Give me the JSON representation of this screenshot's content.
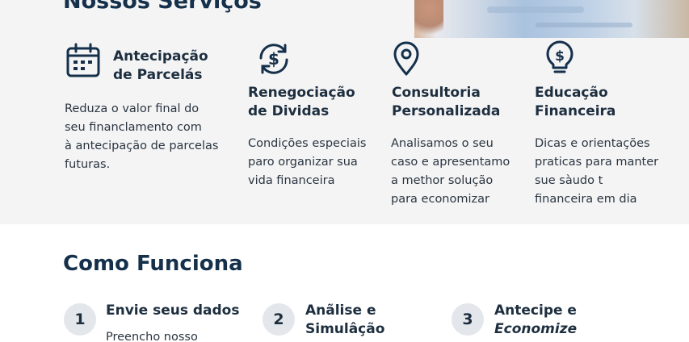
{
  "services": {
    "title": "Nossos Serviços",
    "items": [
      {
        "icon": "calendar-icon",
        "title_lines": [
          "Antecipação",
          "de Parcelás"
        ],
        "desc_lines": [
          "Reduza o valor final do",
          "seu financlamento com",
          "à antecipação de parcelas",
          "futuras."
        ]
      },
      {
        "icon": "refresh-dollar-icon",
        "title_lines": [
          "Renegociação",
          "de Dividas"
        ],
        "desc_lines": [
          "Condições especiais",
          "paro organizar sua",
          "vida financeira"
        ]
      },
      {
        "icon": "location-pin-icon",
        "title_lines": [
          "Consultoria",
          "Personalizada"
        ],
        "desc_lines": [
          "Analisamos o seu",
          "caso e apresentamo",
          "a methor solução",
          "para economizar"
        ]
      },
      {
        "icon": "lightbulb-dollar-icon",
        "title_lines": [
          "Educação",
          "Financeira"
        ],
        "desc_lines": [
          "Dicas e orientações",
          "praticas para manter",
          "sue sàudo t",
          "financeira  em dia"
        ]
      }
    ]
  },
  "how": {
    "title": "Como Funciona",
    "steps": [
      {
        "number": "1",
        "title_lines": [
          "Envie seus dados"
        ],
        "desc": "Preencho nosso"
      },
      {
        "number": "2",
        "title_lines": [
          "Anãlise e",
          "Simulâção"
        ]
      },
      {
        "number": "3",
        "title_lines": [
          "Antecipe e",
          "Economize"
        ]
      }
    ]
  },
  "colors": {
    "heading": "#15304a",
    "section_bg": "#f4f4f5",
    "step_circle": "#e3e6ea"
  }
}
